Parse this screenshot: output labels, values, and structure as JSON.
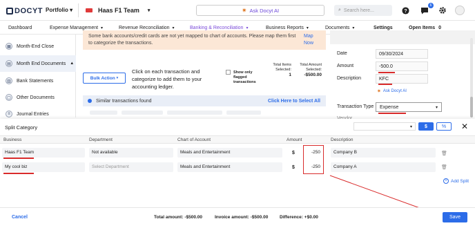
{
  "header": {
    "logo": "DOCYT",
    "portfolio": "Portfolio",
    "business": "Haas F1 Team",
    "ask_ai": "Ask Docyt AI",
    "search_placeholder": "Search here...",
    "notification_count": "6"
  },
  "nav": {
    "items": [
      {
        "label": "Dashboard"
      },
      {
        "label": "Expense Management"
      },
      {
        "label": "Revenue Reconciliation"
      },
      {
        "label": "Banking & Reconciliation"
      },
      {
        "label": "Business Reports"
      },
      {
        "label": "Documents"
      },
      {
        "label": "Settings"
      },
      {
        "label": "Open Items"
      }
    ],
    "open_items_count": "0",
    "active": "Banking & Reconciliation"
  },
  "sidebar": {
    "items": [
      {
        "label": "Month-End Close"
      },
      {
        "label": "Month End Documents"
      },
      {
        "label": "Bank Statements"
      },
      {
        "label": "Other Documents"
      },
      {
        "label": "Journal Entries"
      }
    ]
  },
  "main": {
    "warning": "Some bank accounts/credit cards are not yet mapped to chart of accounts. Please map them first to categorize the transactions.",
    "warning_link": "Map Now",
    "bulk_action": "Bulk Action",
    "instruction": "Click on each transaction and categorize to add them to your accounting ledger.",
    "flagged_label": "Show only flagged transactions",
    "total_items_label": "Total Items Selected:",
    "total_items_value": "1",
    "total_amount_label": "Total Amount Selected:",
    "total_amount_value": "-$500.00",
    "similar_text": "Similar transactions found",
    "select_all": "Click Here to Select All"
  },
  "right_panel": {
    "date_label": "Date",
    "date_value": "09/30/2024",
    "amount_label": "Amount",
    "amount_value": "-500.0",
    "description_label": "Description",
    "description_value": "KFC",
    "ask_ai": "Ask Docyt AI",
    "transaction_type_label": "Transaction Type",
    "transaction_type_value": "Expense",
    "vendor_label": "Vendor"
  },
  "modal": {
    "title": "Split Category",
    "currency_symbol": "$",
    "percent_symbol": "%",
    "columns": [
      "Business",
      "Department",
      "Chart of Account",
      "Amount",
      "Description"
    ],
    "rows": [
      {
        "business": "Haas F1 Team",
        "department": "Not available",
        "account": "Meals and Entertainment",
        "currency": "$",
        "amount": "-250",
        "description": "Company B"
      },
      {
        "business": "My cool biz",
        "department": "Select Department",
        "account": "Meals and Entertainment",
        "currency": "$",
        "amount": "-250",
        "description": "Company A"
      }
    ],
    "add_split": "Add Split",
    "footer": {
      "cancel": "Cancel",
      "total_label": "Total amount:",
      "total_value": "-$500.00",
      "invoice_label": "Invoice amount:",
      "invoice_value": "-$500.00",
      "difference_label": "Difference:",
      "difference_value": "+$0.00",
      "save": "Save"
    }
  },
  "colors": {
    "accent": "#2c6ce8",
    "active_tab": "#7a4ad8",
    "annotation_red": "#d92b2b",
    "warning_bg": "#fce7d6"
  }
}
